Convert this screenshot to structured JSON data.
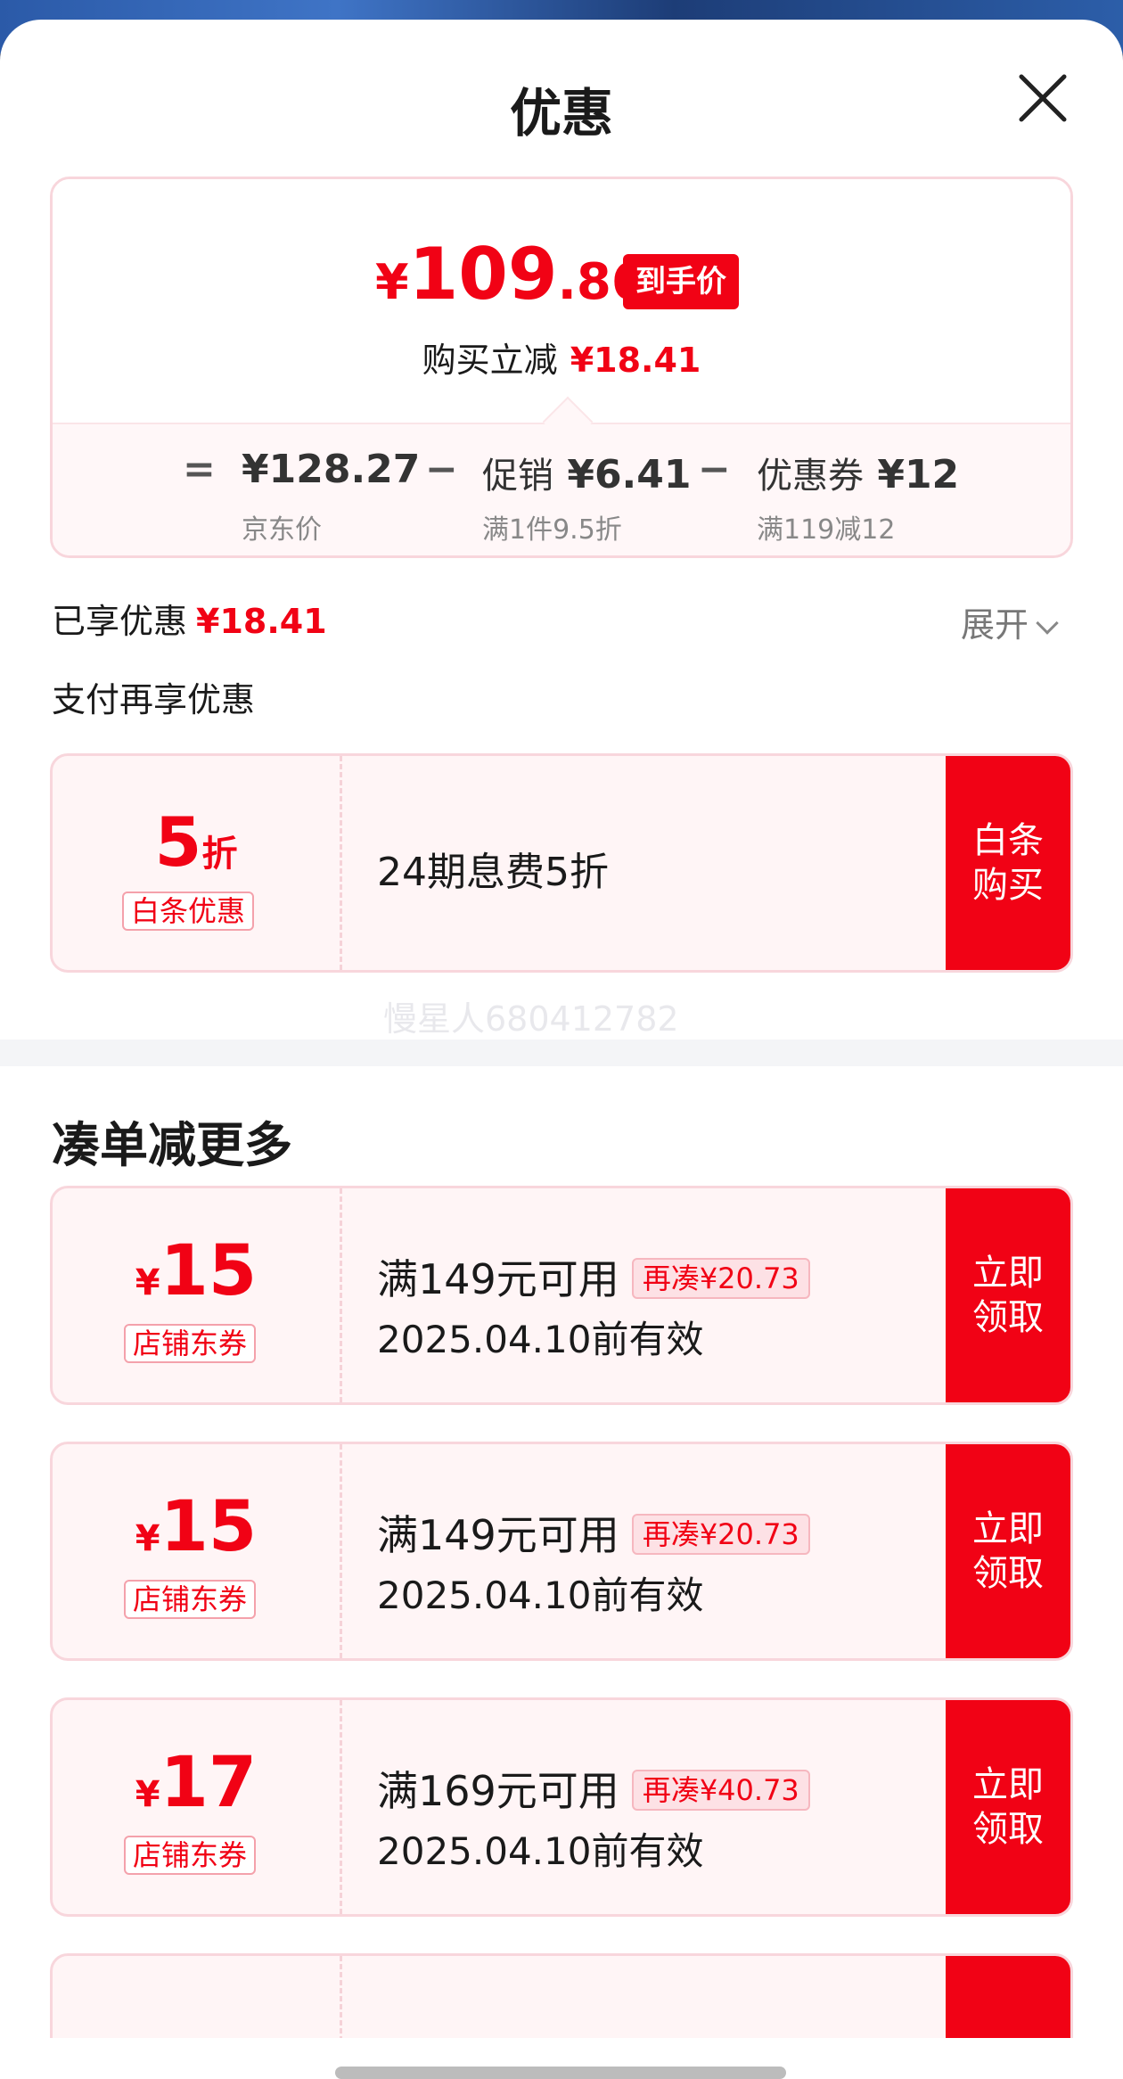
{
  "sheet": {
    "title": "优惠"
  },
  "summary": {
    "final_price_symbol": "¥",
    "final_price_int": "109",
    "final_price_dec": ".86",
    "final_badge": "到手价",
    "reduce_label": "购买立减",
    "reduce_amount": "¥18.41",
    "eq": "=",
    "minus": "−",
    "jd_price": "¥128.27",
    "jd_price_label": "京东价",
    "promo_label": "促销",
    "promo_amount": "¥6.41",
    "promo_sub": "满1件9.5折",
    "coupon_label": "优惠券",
    "coupon_amount": "¥12",
    "coupon_sub": "满119减12"
  },
  "enjoyed": {
    "label": "已享优惠",
    "amount": "¥18.41",
    "expand": "展开"
  },
  "pay": {
    "title": "支付再享优惠",
    "discount_num": "5",
    "discount_unit": "折",
    "tag": "白条优惠",
    "desc": "24期息费5折",
    "action": "白条购买"
  },
  "watermark": "慢星人680412782",
  "coupons_section": {
    "title": "凑单减更多",
    "items": [
      {
        "symbol": "¥",
        "value": "15",
        "tag": "店铺东券",
        "condition": "满149元可用",
        "more": "再凑¥20.73",
        "validity": "2025.04.10前有效",
        "action": "立即领取"
      },
      {
        "symbol": "¥",
        "value": "15",
        "tag": "店铺东券",
        "condition": "满149元可用",
        "more": "再凑¥20.73",
        "validity": "2025.04.10前有效",
        "action": "立即领取"
      },
      {
        "symbol": "¥",
        "value": "17",
        "tag": "店铺东券",
        "condition": "满169元可用",
        "more": "再凑¥40.73",
        "validity": "2025.04.10前有效",
        "action": "立即领取"
      }
    ]
  },
  "colors": {
    "accent": "#f10215",
    "card_bg": "#fff5f6",
    "card_border": "#f8d6dc"
  },
  "icons": {
    "close": "close-icon",
    "expand": "chevron-down-icon"
  }
}
